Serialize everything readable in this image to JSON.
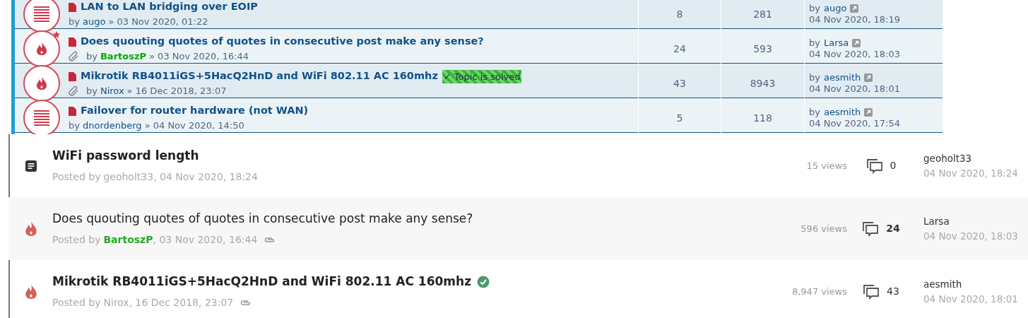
{
  "classic_list": {
    "topics": [
      {
        "kind": "normal",
        "new_star": false,
        "title": "LAN to LAN bridging over EOIP",
        "attachment": false,
        "solved": false,
        "by_label": "by",
        "author": "augo",
        "author_highlighted": false,
        "date": "» 03 Nov 2020, 01:22",
        "replies": "8",
        "views": "281",
        "last_by_label": "by",
        "last_by": "augo",
        "last_time": "04 Nov 2020, 18:19"
      },
      {
        "kind": "hot",
        "new_star": true,
        "title": "Does quouting quotes of quotes in consecutive post make any sense?",
        "attachment": true,
        "solved": false,
        "by_label": "by",
        "author": "BartoszP",
        "author_highlighted": true,
        "date": "» 03 Nov 2020, 16:44",
        "replies": "24",
        "views": "593",
        "last_by_label": "by",
        "last_by": "Larsa",
        "last_time": "04 Nov 2020, 18:03"
      },
      {
        "kind": "hot",
        "new_star": false,
        "title": "Mikrotik RB4011iGS+5HacQ2HnD and WiFi 802.11 AC 160mhz",
        "attachment": true,
        "solved": true,
        "solved_label": "✓ Topic is solved",
        "by_label": "by",
        "author": "Nirox",
        "author_highlighted": false,
        "date": "» 16 Dec 2018, 23:07",
        "replies": "43",
        "views": "8943",
        "last_by_label": "by",
        "last_by": "aesmith",
        "last_time": "04 Nov 2020, 18:01"
      },
      {
        "kind": "normal",
        "new_star": false,
        "title": "Failover for router hardware (not WAN)",
        "attachment": false,
        "solved": false,
        "by_label": "by",
        "author": "dnordenberg",
        "author_highlighted": false,
        "date": "» 04 Nov 2020, 14:50",
        "replies": "5",
        "views": "118",
        "last_by_label": "by",
        "last_by": "aesmith",
        "last_time": "04 Nov 2020, 17:54"
      }
    ]
  },
  "modern_list": {
    "topics": [
      {
        "kind": "normal",
        "unread": true,
        "title": "WiFi password length",
        "solved": false,
        "attachment": false,
        "posted_label": "Posted by",
        "author": "geoholt33",
        "author_highlighted": false,
        "date": ", 04 Nov 2020, 18:24",
        "views": "15 views",
        "replies": "0",
        "last_by": "geoholt33",
        "last_time": "04 Nov 2020, 18:24"
      },
      {
        "kind": "hot",
        "unread": false,
        "title": "Does quouting quotes of quotes in consecutive post make any sense?",
        "solved": false,
        "attachment": true,
        "posted_label": "Posted by",
        "author": "BartoszP",
        "author_highlighted": true,
        "date": ", 03 Nov 2020, 16:44",
        "views": "596 views",
        "replies": "24",
        "last_by": "Larsa",
        "last_time": "04 Nov 2020, 18:03"
      },
      {
        "kind": "hot",
        "unread": true,
        "title": "Mikrotik RB4011iGS+5HacQ2HnD and WiFi 802.11 AC 160mhz",
        "solved": true,
        "attachment": true,
        "posted_label": "Posted by",
        "author": "Nirox",
        "author_highlighted": false,
        "date": ", 16 Dec 2018, 23:07",
        "views": "8,947 views",
        "replies": "43",
        "last_by": "aesmith",
        "last_time": "04 Nov 2020, 18:01"
      }
    ]
  }
}
